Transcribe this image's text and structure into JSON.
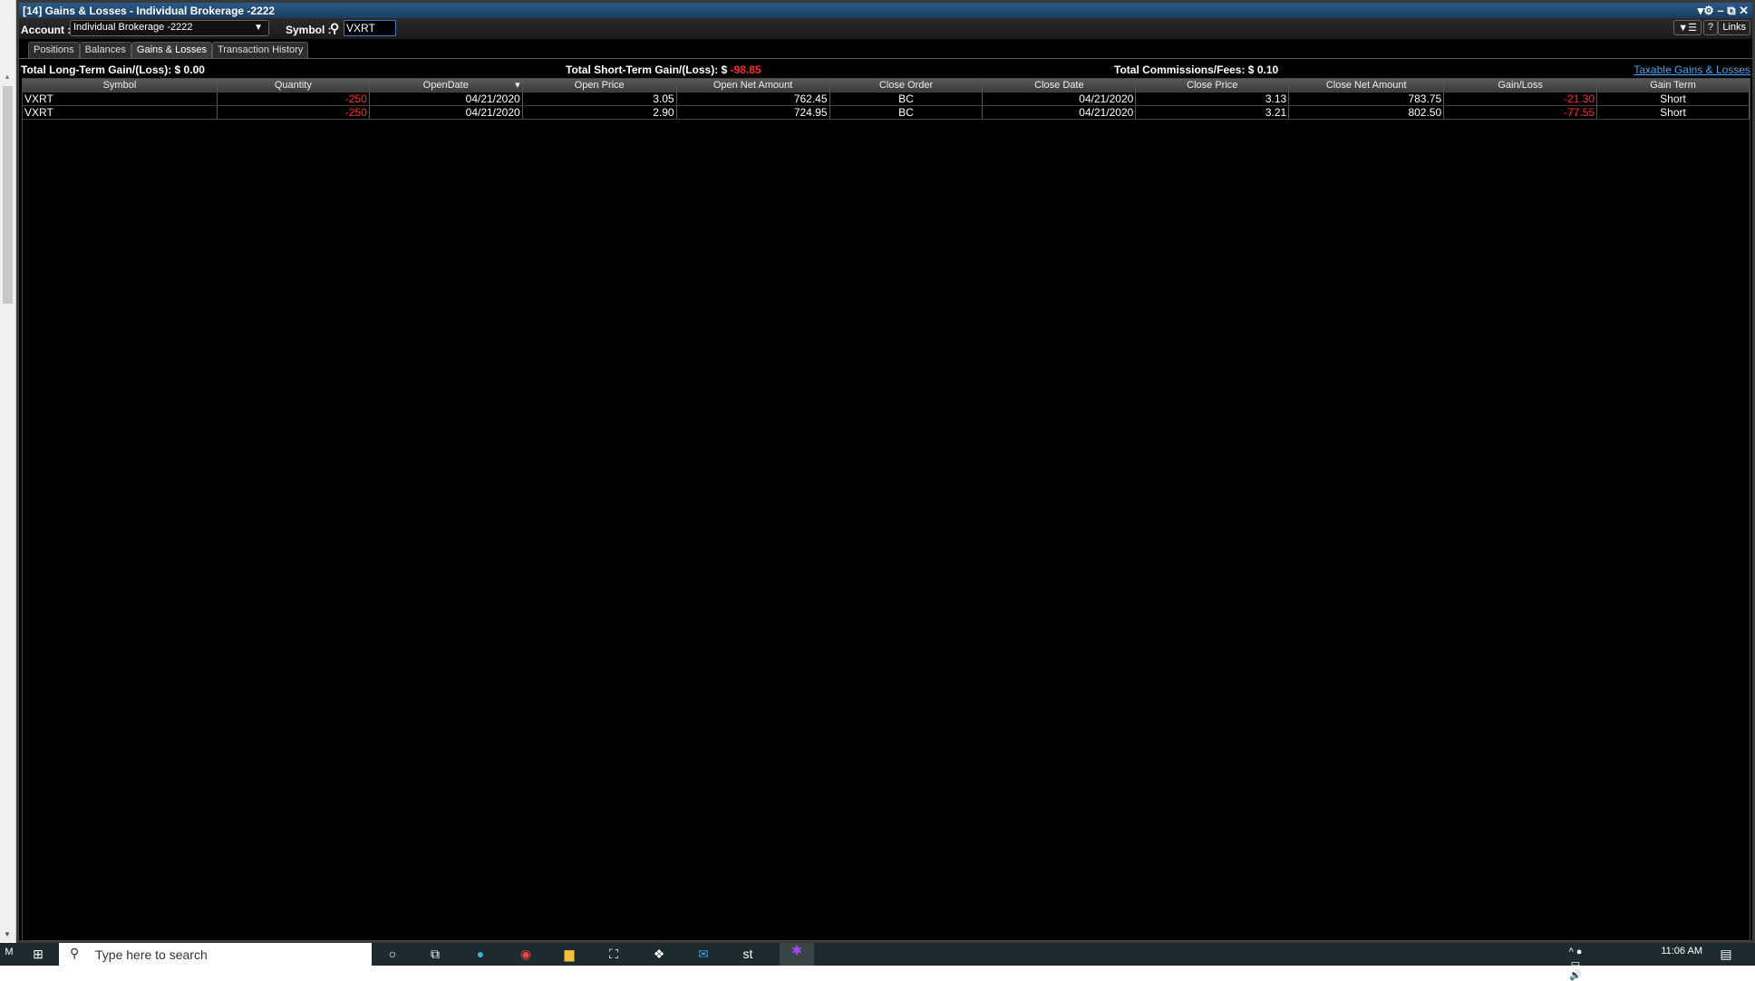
{
  "window": {
    "title": "[14] Gains & Losses - Individual Brokerage -2222",
    "controls": "▾⚙ – ⧉ ✕"
  },
  "toolbar": {
    "account_label": "Account :",
    "account_value": "Individual Brokerage -2222",
    "symbol_label": "Symbol :",
    "symbol_value": "VXRT",
    "menu_btn": "▼☰",
    "help_btn": "?",
    "links_btn": "Links"
  },
  "tabs": [
    "Positions",
    "Balances",
    "Gains & Losses",
    "Transaction History"
  ],
  "summary": {
    "long_label": "Total Long-Term Gain/(Loss): $ 0.00",
    "short_label": "Total Short-Term Gain/(Loss): $",
    "short_value": "-98.85",
    "comm_label": "Total Commissions/Fees:  $ 0.10",
    "link": "Taxable Gains & Losses"
  },
  "table": {
    "headers": [
      "Symbol",
      "Quantity",
      "OpenDate",
      "Open Price",
      "Open Net Amount",
      "Close Order",
      "Close Date",
      "Close Price",
      "Close Net Amount",
      "Gain/Loss",
      "Gain Term"
    ],
    "rows": [
      [
        "VXRT",
        "-250",
        "04/21/2020",
        "3.05",
        "762.45",
        "BC",
        "04/21/2020",
        "3.13",
        "783.75",
        "-21.30",
        "Short"
      ],
      [
        "VXRT",
        "-250",
        "04/21/2020",
        "2.90",
        "724.95",
        "BC",
        "04/21/2020",
        "3.21",
        "802.50",
        "-77.55",
        "Short"
      ]
    ]
  },
  "taskbar": {
    "search_placeholder": "Type here to search",
    "time": "11:06 AM"
  }
}
